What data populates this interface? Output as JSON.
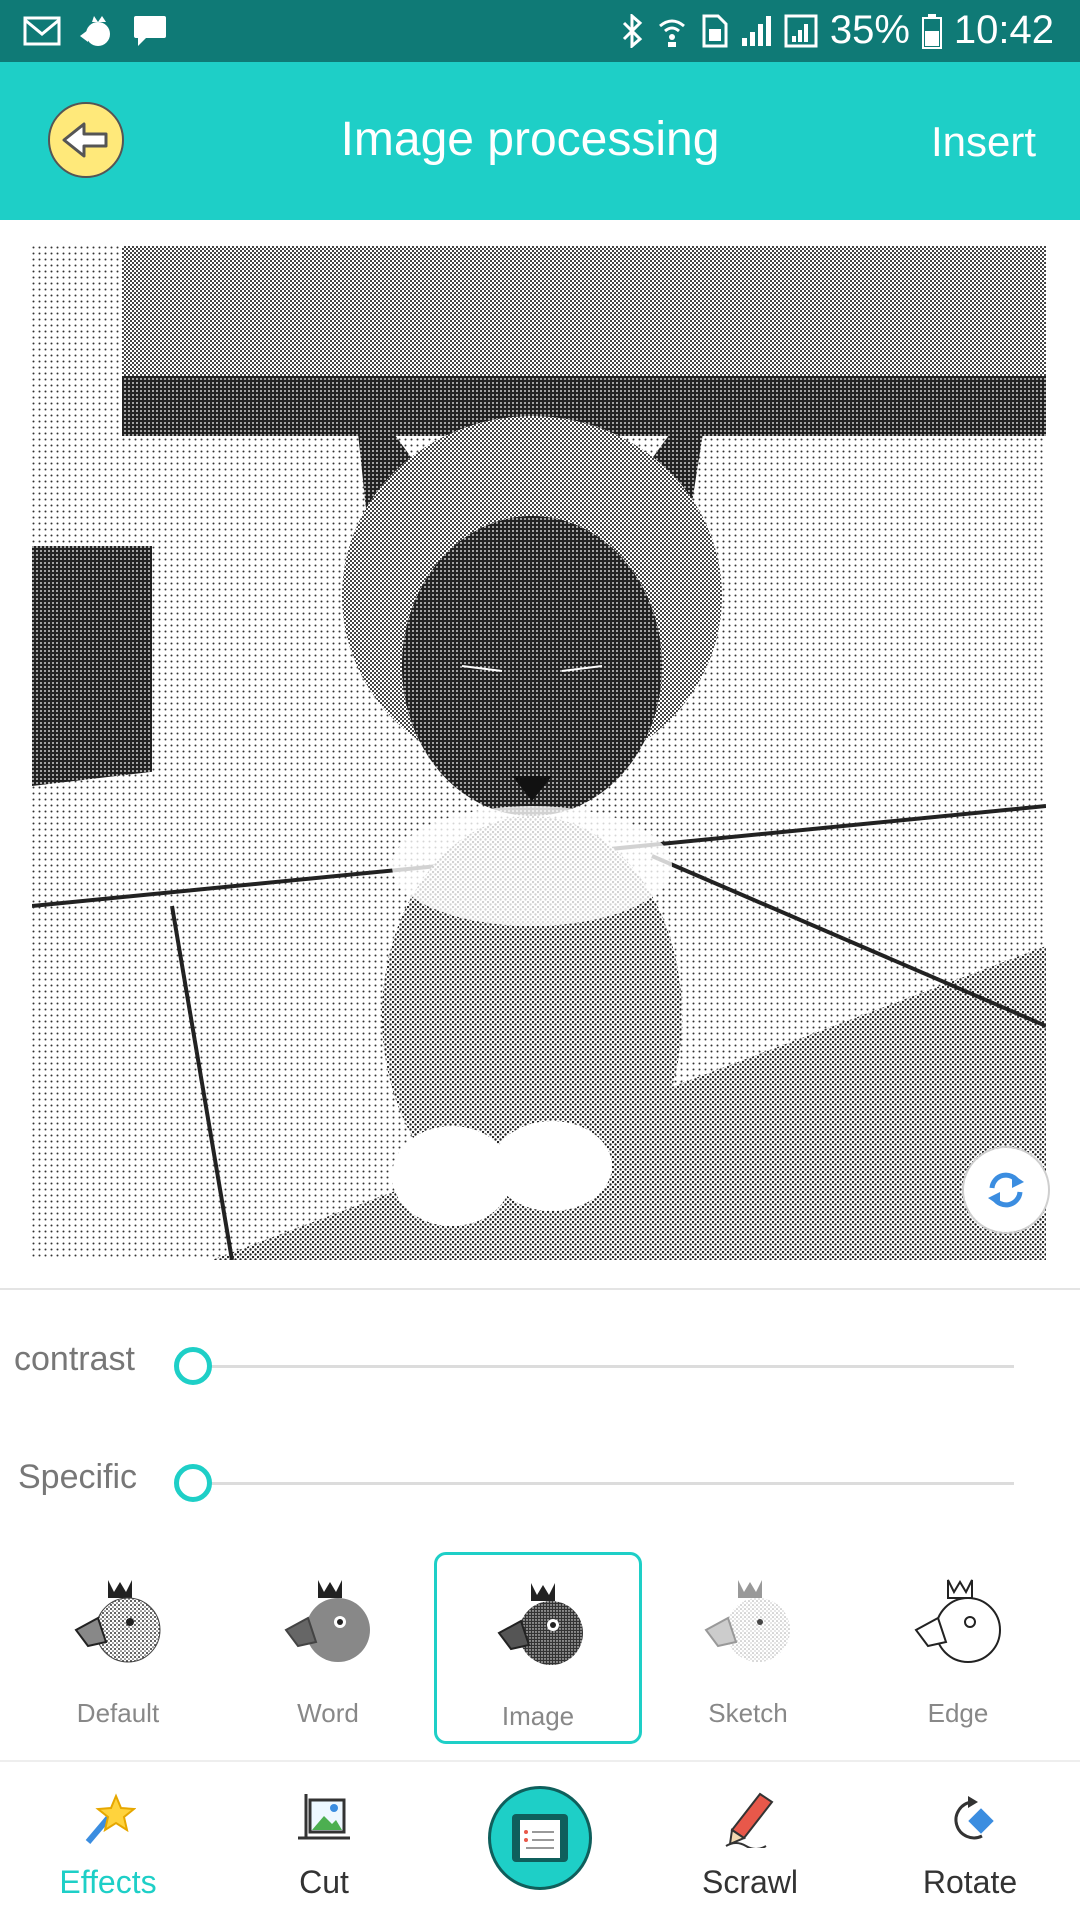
{
  "status_bar": {
    "battery": "35%",
    "time": "10:42",
    "left_icons": [
      "mail-icon",
      "bird-notification-icon",
      "chat-icon"
    ],
    "right_icons": [
      "bluetooth-icon",
      "wifi-calling-icon",
      "sim-icon",
      "signal-icon",
      "signal-icon",
      "battery-icon"
    ]
  },
  "app_bar": {
    "title": "Image processing",
    "insert_label": "Insert",
    "back_icon": "back-arrow-icon"
  },
  "image": {
    "description_icon": "dithered-cat-photo",
    "refresh_icon": "refresh-icon"
  },
  "sliders": {
    "contrast": {
      "label": "contrast",
      "value": 0
    },
    "specific": {
      "label": "Specific",
      "value": 0
    }
  },
  "effects": [
    {
      "label": "Default",
      "selected": false
    },
    {
      "label": "Word",
      "selected": false
    },
    {
      "label": "Image",
      "selected": true
    },
    {
      "label": "Sketch",
      "selected": false
    },
    {
      "label": "Edge",
      "selected": false
    }
  ],
  "bottom_nav": {
    "items": [
      {
        "label": "Effects",
        "icon": "magic-wand-icon",
        "active": true
      },
      {
        "label": "Cut",
        "icon": "crop-image-icon",
        "active": false
      },
      {
        "label": "",
        "icon": "receipt-print-icon",
        "active": false
      },
      {
        "label": "Scrawl",
        "icon": "pencil-icon",
        "active": false
      },
      {
        "label": "Rotate",
        "icon": "rotate-icon",
        "active": false
      }
    ]
  },
  "colors": {
    "accent": "#1ecfc7",
    "status_bar": "#0f7a76",
    "back_button": "#ffe97a",
    "active_nav": "#1ecfc7",
    "label_gray": "#888888"
  }
}
